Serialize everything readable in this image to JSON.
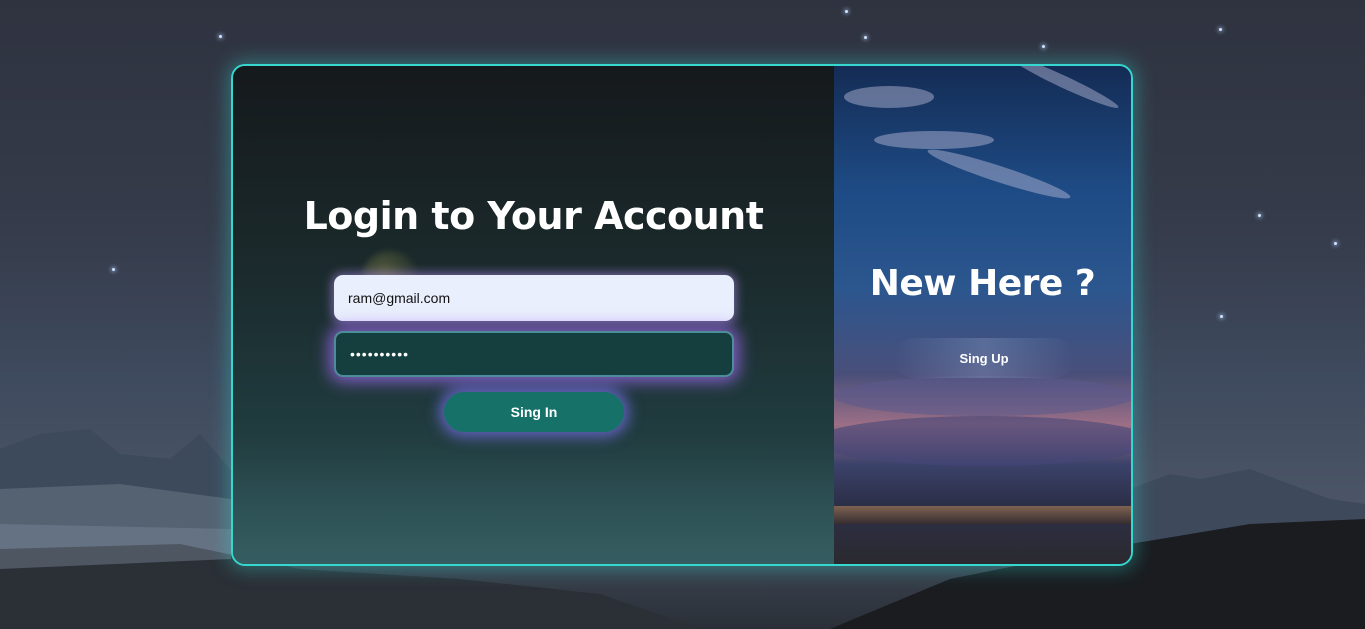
{
  "login": {
    "title": "Login to Your Account",
    "email_value": "ram@gmail.com",
    "password_value": "••••••••••",
    "signin_label": "Sing In"
  },
  "signup": {
    "title": "New Here ?",
    "signup_label": "Sing Up"
  },
  "colors": {
    "accent_border": "#35d7cf",
    "button_primary": "#167269",
    "glow": "#8a6cff"
  }
}
